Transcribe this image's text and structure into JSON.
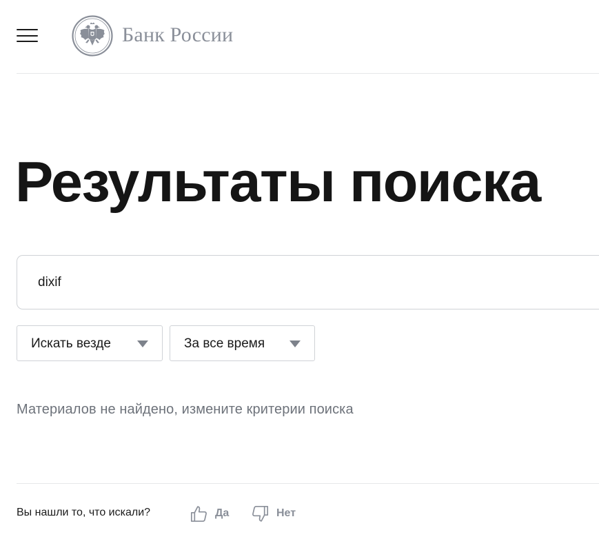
{
  "header": {
    "menu_icon": "hamburger-menu-icon",
    "logo_icon": "double-headed-eagle-emblem",
    "logo_text": "Банк России"
  },
  "main": {
    "title": "Результаты поиска",
    "search": {
      "value": "dixif",
      "placeholder": ""
    },
    "filters": [
      {
        "label": "Искать везде",
        "icon": "chevron-down-icon"
      },
      {
        "label": "За все время",
        "icon": "chevron-down-icon"
      }
    ],
    "empty_message": "Материалов не найдено, измените критерии поиска"
  },
  "feedback": {
    "question": "Вы нашли то, что искали?",
    "yes_label": "Да",
    "yes_icon": "thumbs-up-icon",
    "no_label": "Нет",
    "no_icon": "thumbs-down-icon"
  },
  "colors": {
    "text": "#1a1a1a",
    "muted": "#6d727a",
    "logo_gray": "#8a8f99",
    "border": "#cfd2d6",
    "divider": "#e6e7e9"
  }
}
